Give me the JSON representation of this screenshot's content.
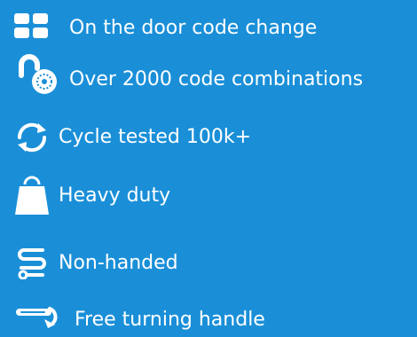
{
  "colors": {
    "background": "#1a8fd8",
    "foreground": "#ffffff"
  },
  "features": [
    {
      "icon": "grid-squares-icon",
      "label": "On the door code change"
    },
    {
      "icon": "open-padlock-dial-icon",
      "label": "Over 2000 code combinations"
    },
    {
      "icon": "cycle-arrows-icon",
      "label": "Cycle tested 100k+"
    },
    {
      "icon": "weight-icon",
      "label": "Heavy duty"
    },
    {
      "icon": "non-handed-icon",
      "label": "Non-handed"
    },
    {
      "icon": "turning-handle-icon",
      "label": "Free turning handle"
    }
  ]
}
